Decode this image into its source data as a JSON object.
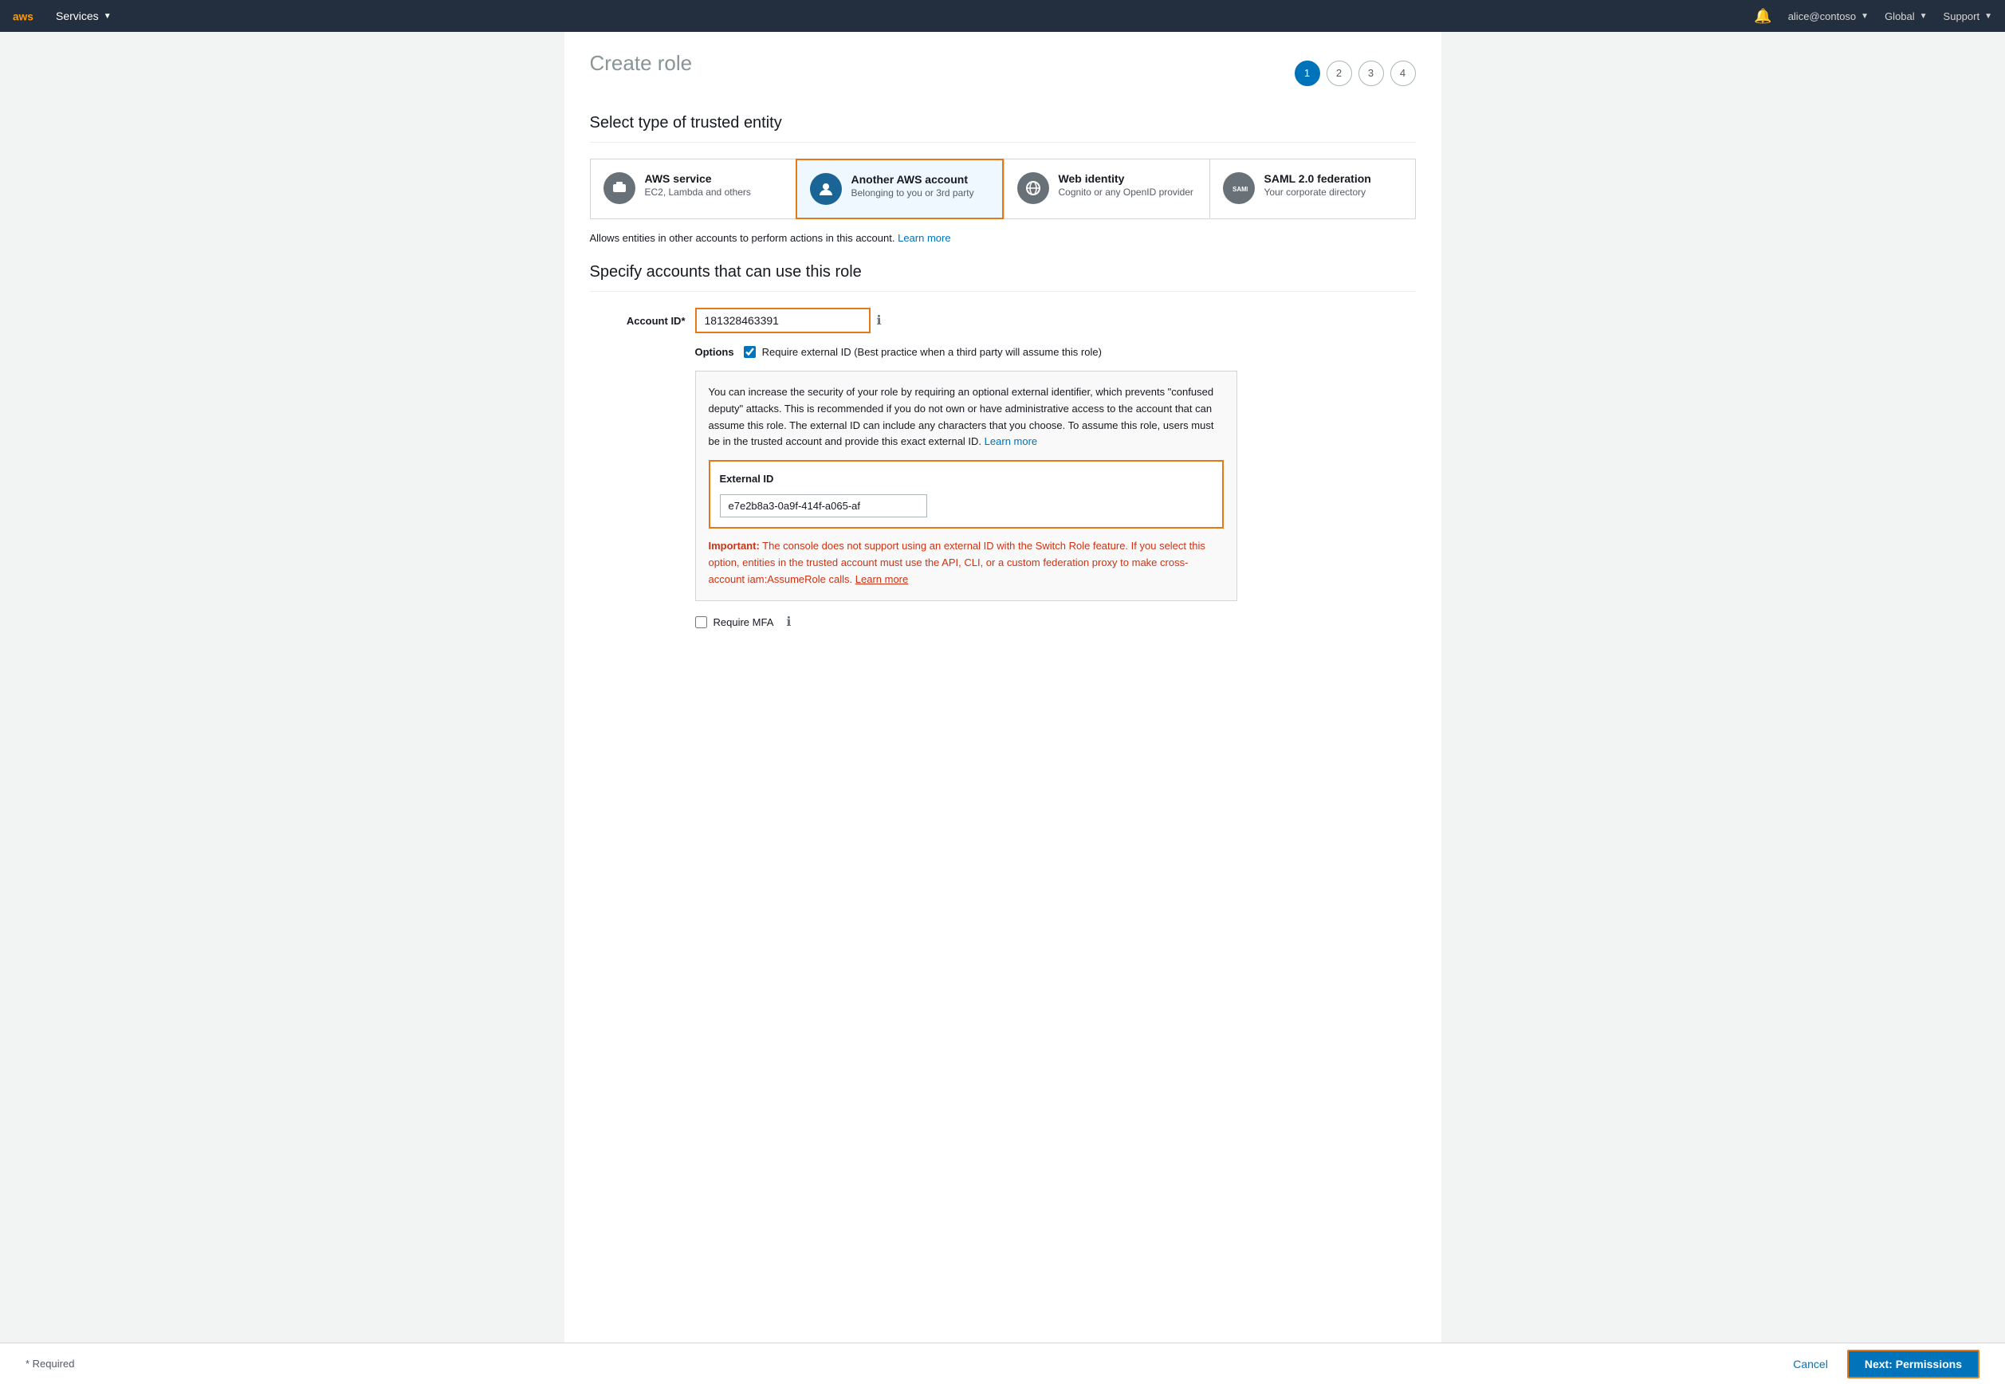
{
  "navbar": {
    "services_label": "Services",
    "bell_label": "Notifications",
    "user_label": "alice@contoso",
    "region_label": "Global",
    "support_label": "Support"
  },
  "page": {
    "title": "Create role",
    "step1_label": "1",
    "step2_label": "2",
    "step3_label": "3",
    "step4_label": "4"
  },
  "section1": {
    "header": "Select type of trusted entity",
    "cards": [
      {
        "title": "AWS service",
        "subtitle": "EC2, Lambda and others",
        "selected": false
      },
      {
        "title": "Another AWS account",
        "subtitle": "Belonging to you or 3rd party",
        "selected": true
      },
      {
        "title": "Web identity",
        "subtitle": "Cognito or any OpenID provider",
        "selected": false
      },
      {
        "title": "SAML 2.0 federation",
        "subtitle": "Your corporate directory",
        "selected": false
      }
    ],
    "info_text": "Allows entities in other accounts to perform actions in this account.",
    "learn_more": "Learn more"
  },
  "section2": {
    "header": "Specify accounts that can use this role",
    "account_id_label": "Account ID*",
    "account_id_value": "181328463391",
    "options_label": "Options",
    "require_external_id_label": "Require external ID (Best practice when a third party will assume this role)",
    "require_external_id_checked": true,
    "info_box_text": "You can increase the security of your role by requiring an optional external identifier, which prevents \"confused deputy\" attacks. This is recommended if you do not own or have administrative access to the account that can assume this role. The external ID can include any characters that you choose. To assume this role, users must be in the trusted account and provide this exact external ID.",
    "info_box_learn_more": "Learn more",
    "external_id_label": "External ID",
    "external_id_value": "e7e2b8a3-0a9f-414f-a065-af",
    "important_label": "Important:",
    "important_text": "The console does not support using an external ID with the Switch Role feature. If you select this option, entities in the trusted account must use the API, CLI, or a custom federation proxy to make cross-account iam:AssumeRole calls.",
    "important_learn_more": "Learn more",
    "require_mfa_label": "Require MFA"
  },
  "footer": {
    "required_label": "* Required",
    "cancel_label": "Cancel",
    "next_label": "Next: Permissions"
  }
}
